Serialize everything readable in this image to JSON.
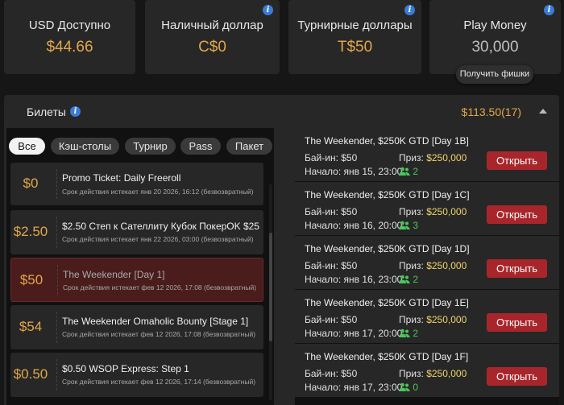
{
  "balances": [
    {
      "label": "USD Доступно",
      "value": "$44.66",
      "info": false,
      "value_color": "gold"
    },
    {
      "label": "Наличный доллар",
      "value": "C$0",
      "info": true,
      "value_color": "gold"
    },
    {
      "label": "Турнирные доллары",
      "value": "T$50",
      "info": true,
      "value_color": "gold"
    },
    {
      "label": "Play Money",
      "value": "30,000",
      "info": true,
      "value_color": "grey"
    }
  ],
  "tooltip": "Получить фишки",
  "tickets_panel": {
    "title": "Билеты",
    "total": "$113.50(17)",
    "filters": [
      "Все",
      "Кэш-столы",
      "Турнир",
      "Pass",
      "Пакет"
    ],
    "active_filter": "Все",
    "tickets": [
      {
        "amount": "$0",
        "name": "Promo Ticket: Daily Freeroll",
        "expiry": "Срок действия истекает янв 20 2026, 16:12 (безвозвратный)",
        "selected": false
      },
      {
        "amount": "$2.50",
        "name": "$2.50 Степ к Сателлиту Кубок ПокерOK $25",
        "expiry": "Срок действия истекает янв 22 2026, 03:00 (безвозвратный)",
        "selected": false
      },
      {
        "amount": "$50",
        "name": "The Weekender [Day 1]",
        "expiry": "Срок действия истекает фев 12 2026, 17:08 (безвозвратный)",
        "selected": true
      },
      {
        "amount": "$54",
        "name": "The Weekender Omaholic Bounty [Stage 1]",
        "expiry": "Срок действия истекает фев 12 2026, 17:08 (безвозвратный)",
        "selected": false
      },
      {
        "amount": "$0.50",
        "name": "$0.50 WSOP Express: Step 1",
        "expiry": "Срок действия истекает фев 12 2026, 17:14 (безвозвратный)",
        "selected": false
      }
    ],
    "tournaments": [
      {
        "title": "The Weekender, $250K GTD [Day 1B]",
        "buyin": "Бай-ин: $50",
        "start": "Начало: янв 15, 23:00",
        "prize_label": "Приз:",
        "prize": "$250,000",
        "players": "2",
        "button": "Открыть"
      },
      {
        "title": "The Weekender, $250K GTD [Day 1C]",
        "buyin": "Бай-ин: $50",
        "start": "Начало: янв 16, 20:00",
        "prize_label": "Приз:",
        "prize": "$250,000",
        "players": "3",
        "button": "Открыть"
      },
      {
        "title": "The Weekender, $250K GTD [Day 1D]",
        "buyin": "Бай-ин: $50",
        "start": "Начало: янв 16, 23:00",
        "prize_label": "Приз:",
        "prize": "$250,000",
        "players": "2",
        "button": "Открыть"
      },
      {
        "title": "The Weekender, $250K GTD [Day 1E]",
        "buyin": "Бай-ин: $50",
        "start": "Начало: янв 17, 20:00",
        "prize_label": "Приз:",
        "prize": "$250,000",
        "players": "2",
        "button": "Открыть"
      },
      {
        "title": "The Weekender, $250K GTD [Day 1F]",
        "buyin": "Бай-ин: $50",
        "start": "Начало: янв 17, 23:00",
        "prize_label": "Приз:",
        "prize": "$250,000",
        "players": "0",
        "button": "Открыть"
      }
    ]
  },
  "colors": {
    "gold": "#e3a64a",
    "button_red": "#a8262b",
    "prize_yellow": "#f1d46b",
    "players_green": "#4cc65b",
    "info_blue": "#3a7bd5"
  },
  "icons": {
    "info": "info-icon",
    "people": "people-icon",
    "chevron": "chevron-up-icon"
  }
}
